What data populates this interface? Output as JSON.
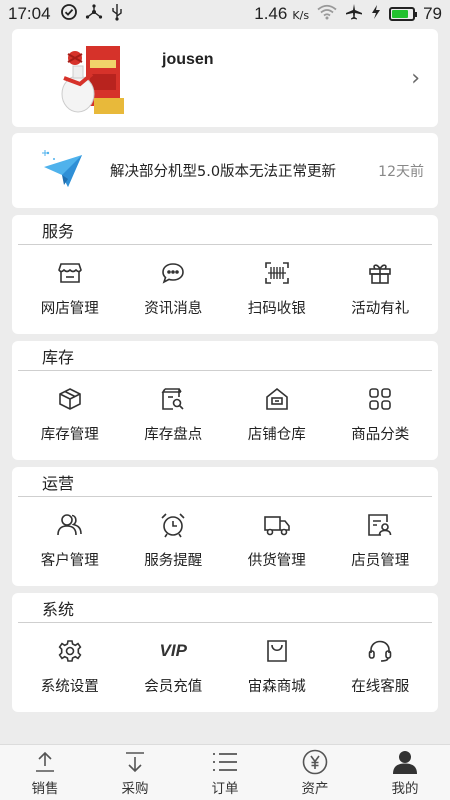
{
  "status_bar": {
    "time": "17:04",
    "speed": "1.46",
    "speed_unit": "K/s",
    "battery": "79",
    "battery_color": "#22c12e"
  },
  "profile": {
    "username": "jousen",
    "chevron": "›"
  },
  "notice": {
    "message": "解决部分机型5.0版本无法正常更新",
    "time": "12天前",
    "icon": "paper-plane-icon"
  },
  "sections": [
    {
      "title": "服务",
      "items": [
        {
          "label": "网店管理",
          "icon": "store-icon"
        },
        {
          "label": "资讯消息",
          "icon": "chat-bubble-icon"
        },
        {
          "label": "扫码收银",
          "icon": "barcode-scan-icon"
        },
        {
          "label": "活动有礼",
          "icon": "gift-icon"
        }
      ]
    },
    {
      "title": "库存",
      "items": [
        {
          "label": "库存管理",
          "icon": "box-icon"
        },
        {
          "label": "库存盘点",
          "icon": "inventory-check-icon"
        },
        {
          "label": "店铺仓库",
          "icon": "warehouse-icon"
        },
        {
          "label": "商品分类",
          "icon": "grid-categories-icon"
        }
      ]
    },
    {
      "title": "运营",
      "items": [
        {
          "label": "客户管理",
          "icon": "customers-icon"
        },
        {
          "label": "服务提醒",
          "icon": "alarm-clock-icon"
        },
        {
          "label": "供货管理",
          "icon": "truck-icon"
        },
        {
          "label": "店员管理",
          "icon": "staff-card-icon"
        }
      ]
    },
    {
      "title": "系统",
      "items": [
        {
          "label": "系统设置",
          "icon": "gear-icon"
        },
        {
          "label": "会员充值",
          "icon": "vip-icon",
          "icon_text": "VIP"
        },
        {
          "label": "宙森商城",
          "icon": "shopping-bag-icon"
        },
        {
          "label": "在线客服",
          "icon": "headset-icon"
        }
      ]
    }
  ],
  "tabs": [
    {
      "label": "销售",
      "icon": "upload-icon",
      "active": false
    },
    {
      "label": "采购",
      "icon": "download-icon",
      "active": false
    },
    {
      "label": "订单",
      "icon": "list-icon",
      "active": false
    },
    {
      "label": "资产",
      "icon": "yen-circle-icon",
      "active": false
    },
    {
      "label": "我的",
      "icon": "person-icon",
      "active": true
    }
  ]
}
